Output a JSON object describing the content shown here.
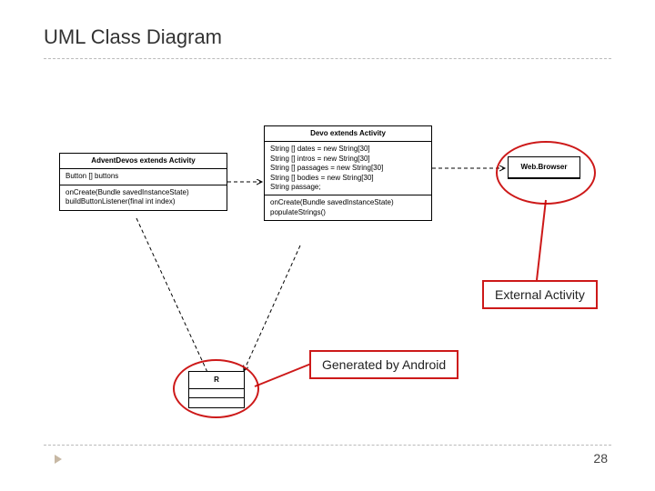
{
  "title": "UML Class Diagram",
  "page_number": "28",
  "classes": {
    "advent": {
      "name": "AdventDevos extends Activity",
      "attrs": [
        "Button [] buttons"
      ],
      "ops": [
        "onCreate(Bundle savedInstanceState)",
        "buildButtonListener(final int index)"
      ]
    },
    "devo": {
      "name": "Devo extends Activity",
      "attrs": [
        "String [] dates = new String[30]",
        "String [] intros = new String[30]",
        "String [] passages = new String[30]",
        "String [] bodies = new String[30]",
        "String passage;"
      ],
      "ops": [
        "onCreate(Bundle savedInstanceState)",
        "populateStrings()"
      ]
    },
    "web": {
      "name": "Web.Browser"
    },
    "r": {
      "name": "R"
    }
  },
  "callouts": {
    "external": "External Activity",
    "generated": "Generated by Android"
  }
}
